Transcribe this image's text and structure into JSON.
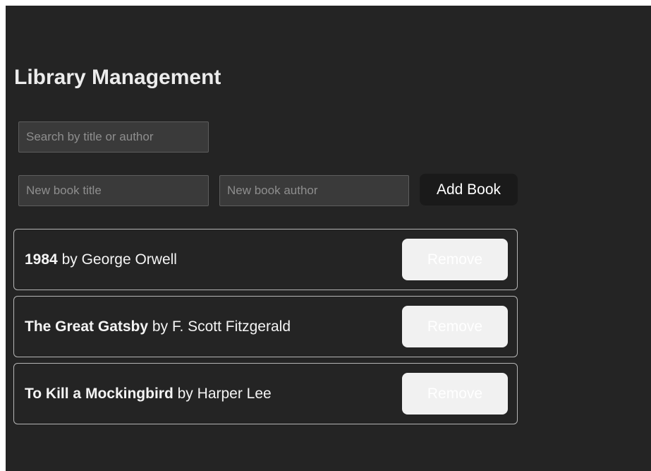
{
  "header": {
    "title": "Library Management"
  },
  "search": {
    "placeholder": "Search by title or author",
    "value": ""
  },
  "add_form": {
    "title_placeholder": "New book title",
    "author_placeholder": "New book author",
    "add_label": "Add Book"
  },
  "books": [
    {
      "title": "1984",
      "by": "by",
      "author": "George Orwell",
      "remove_label": "Remove"
    },
    {
      "title": "The Great Gatsby",
      "by": "by",
      "author": "F. Scott Fitzgerald",
      "remove_label": "Remove"
    },
    {
      "title": "To Kill a Mockingbird",
      "by": "by",
      "author": "Harper Lee",
      "remove_label": "Remove"
    }
  ],
  "colors": {
    "background": "#242424",
    "field_background": "#3a3a3a",
    "button_dark": "#1a1a1a",
    "remove_button": "#f1f1f1",
    "card_border": "#b5b5b5"
  }
}
